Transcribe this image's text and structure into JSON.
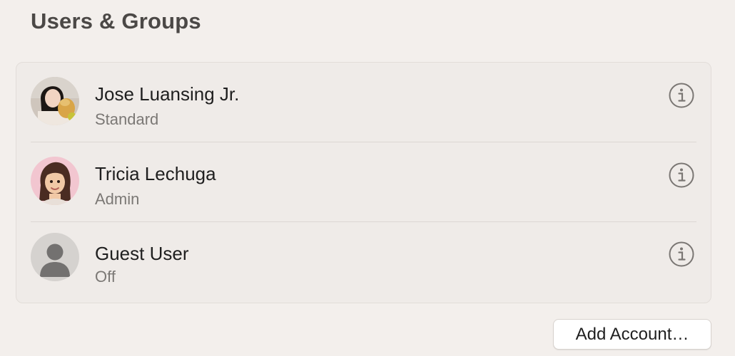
{
  "header": {
    "title": "Users & Groups"
  },
  "users": [
    {
      "name": "Jose Luansing Jr.",
      "role": "Standard",
      "avatar_icon": "photo-avatar-icon"
    },
    {
      "name": "Tricia Lechuga",
      "role": "Admin",
      "avatar_icon": "memoji-avatar-icon"
    },
    {
      "name": "Guest User",
      "role": "Off",
      "avatar_icon": "guest-silhouette-icon"
    }
  ],
  "actions": {
    "add_account_label": "Add Account…"
  },
  "colors": {
    "background": "#f3efec",
    "panel": "#efebe8",
    "text_primary": "#1f1f1f",
    "text_secondary": "#7b7875",
    "info_icon": "#7a7673"
  }
}
